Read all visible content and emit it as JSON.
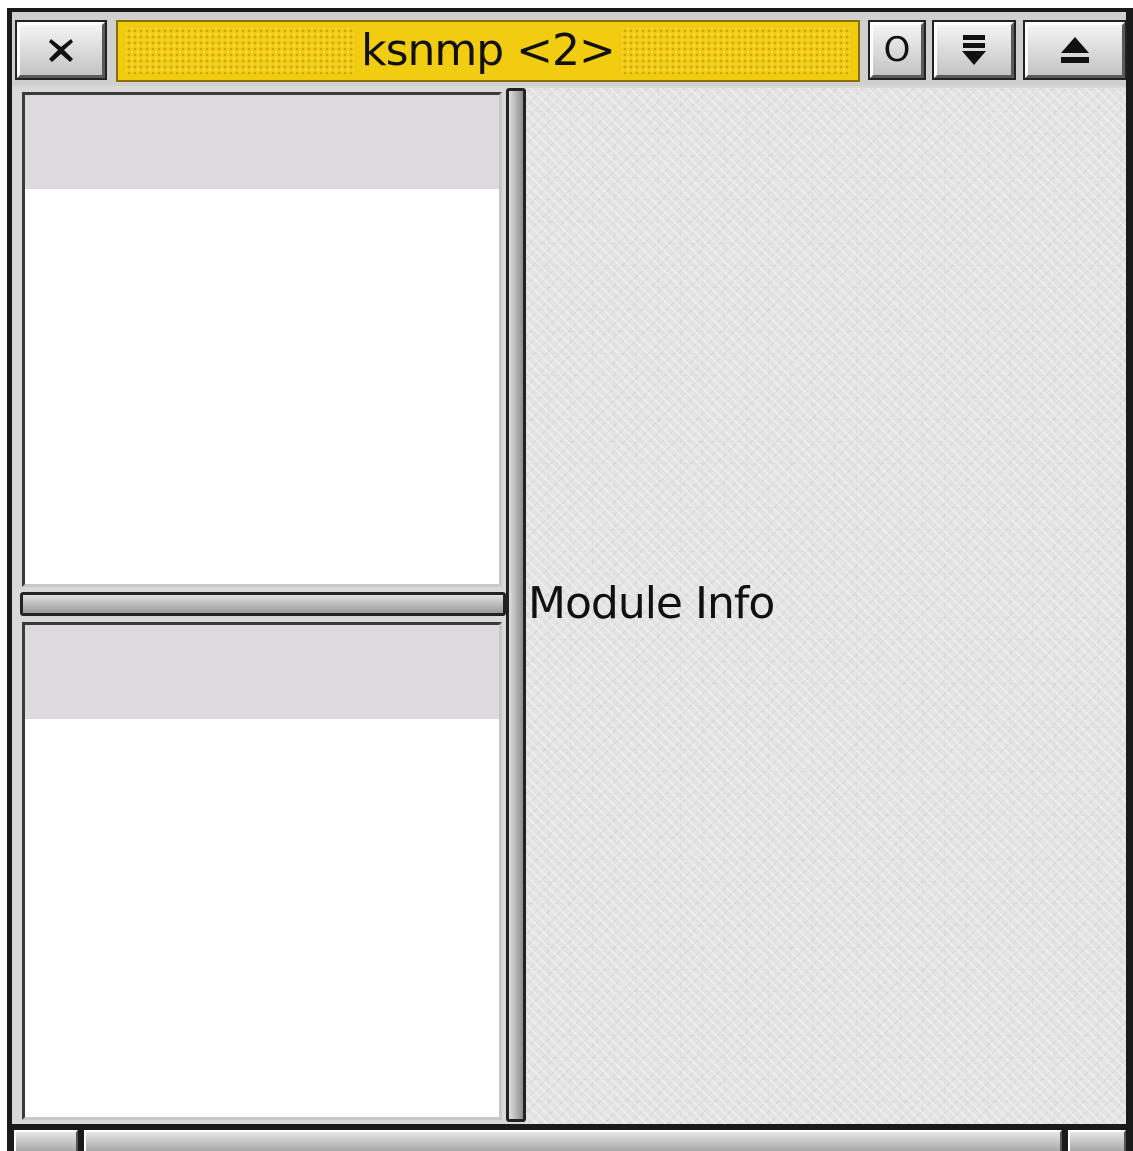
{
  "window": {
    "title": "ksnmp <2>",
    "title_color": "#f2cc10"
  },
  "titlebar": {
    "buttons": [
      {
        "name": "close",
        "icon": "close-x-icon"
      },
      {
        "name": "iconify",
        "icon": "circle-icon",
        "label": "O"
      },
      {
        "name": "shade",
        "icon": "shade-down-icon"
      },
      {
        "name": "maximize",
        "icon": "eject-up-icon"
      }
    ],
    "iconify_label": "O"
  },
  "info_pane": {
    "label": "Module Info"
  }
}
